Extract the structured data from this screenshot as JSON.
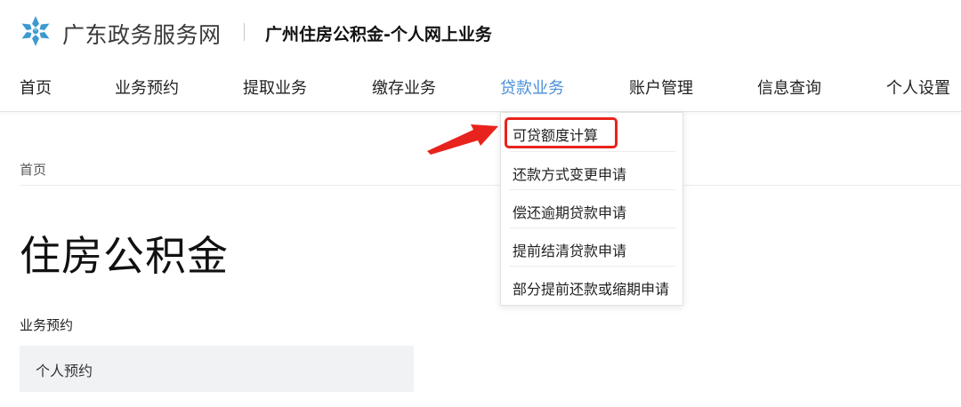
{
  "header": {
    "brand": "广东政务服务网",
    "site_title": "广州住房公积金-个人网上业务"
  },
  "nav": {
    "items": [
      {
        "label": "首页"
      },
      {
        "label": "业务预约"
      },
      {
        "label": "提取业务"
      },
      {
        "label": "缴存业务"
      },
      {
        "label": "贷款业务",
        "active": true
      },
      {
        "label": "账户管理"
      },
      {
        "label": "信息查询"
      },
      {
        "label": "个人设置"
      }
    ]
  },
  "dropdown": {
    "items": [
      {
        "label": "可贷额度计算",
        "highlighted": true
      },
      {
        "label": "还款方式变更申请"
      },
      {
        "label": "偿还逾期贷款申请"
      },
      {
        "label": "提前结清贷款申请"
      },
      {
        "label": "部分提前还款或缩期申请"
      }
    ]
  },
  "breadcrumb": "首页",
  "page_title": "住房公积金",
  "section": {
    "label": "业务预约",
    "box_text": "个人预约"
  },
  "colors": {
    "accent": "#4a8fd8",
    "annotation_red": "#e8231d",
    "logo_blue": "#3d9ad1"
  },
  "icons": {
    "logo": "snowflake-logo-icon",
    "annotation": "red-arrow-annotation"
  }
}
